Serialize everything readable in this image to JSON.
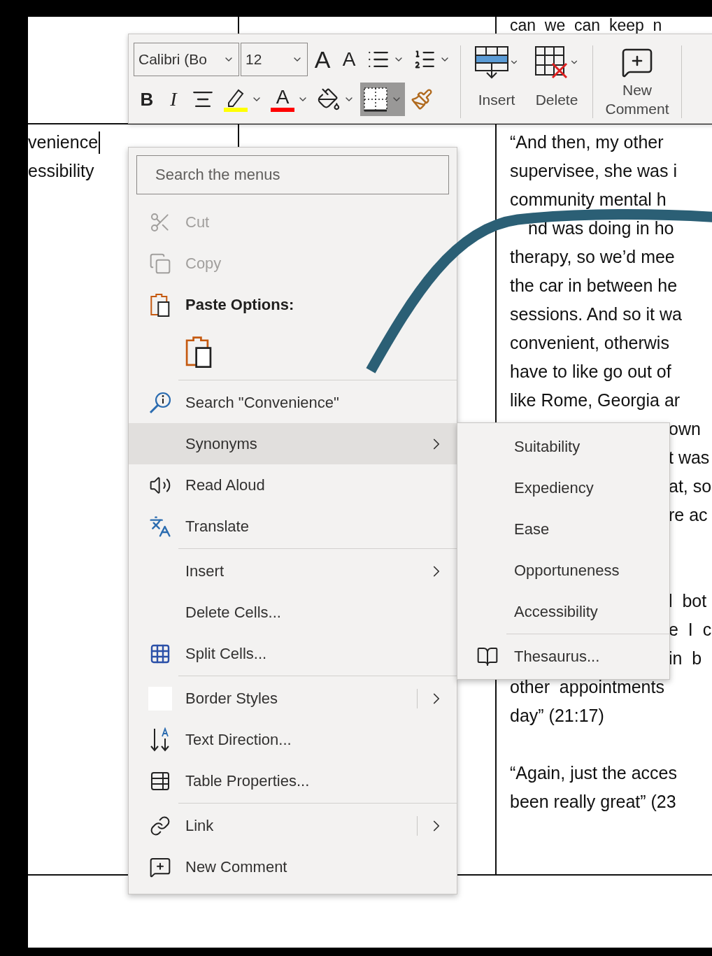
{
  "document": {
    "top_right_cell": "can  we  can  keep  n",
    "left_lines": [
      "venience",
      "essibility"
    ],
    "cursor": true,
    "right_lines": [
      {
        "kind": "line",
        "text": "“And then, my other"
      },
      {
        "kind": "line",
        "text": "supervisee, she was i"
      },
      {
        "kind": "line",
        "text": "community mental h"
      },
      {
        "kind": "after-arc",
        "text": "nd was doing in ho"
      },
      {
        "kind": "line",
        "text": "therapy, so we’d mee"
      },
      {
        "kind": "line",
        "text": "the car in between he"
      },
      {
        "kind": "line",
        "text": "sessions. And so it wa"
      },
      {
        "kind": "line",
        "text": "convenient, otherwis"
      },
      {
        "kind": "line",
        "text": "have to like go out of"
      },
      {
        "kind": "line",
        "text": "like Rome, Georgia ar"
      },
      {
        "kind": "covered",
        "text": "own"
      },
      {
        "kind": "covered",
        "text": "t was"
      },
      {
        "kind": "covered",
        "text": "at, so"
      },
      {
        "kind": "covered",
        "text": "re ac"
      },
      {
        "kind": "gap"
      },
      {
        "kind": "gap"
      },
      {
        "kind": "covered",
        "text": "l  bot"
      },
      {
        "kind": "covered",
        "text": "e  I  c"
      },
      {
        "kind": "covered",
        "text": "in  b"
      },
      {
        "kind": "line",
        "text": "other  appointments"
      },
      {
        "kind": "line",
        "text": "day” (21:17)"
      },
      {
        "kind": "gap"
      },
      {
        "kind": "line",
        "text": "“Again, just the acces"
      },
      {
        "kind": "line",
        "text": "been really great” (23"
      }
    ]
  },
  "mini_toolbar": {
    "font": "Calibri (Bo",
    "size": "12",
    "row1": [
      {
        "kind": "grow",
        "glyph": "A",
        "dropdown": false
      },
      {
        "kind": "shrink",
        "glyph": "A",
        "dropdown": false
      },
      {
        "kind": "bullets",
        "dropdown": true
      },
      {
        "kind": "numbering",
        "dropdown": true
      }
    ],
    "row2": [
      {
        "kind": "bold",
        "glyph": "B",
        "dropdown": false,
        "selected": false
      },
      {
        "kind": "italic",
        "glyph": "I",
        "dropdown": false,
        "selected": false
      },
      {
        "kind": "align",
        "dropdown": false,
        "selected": false
      },
      {
        "kind": "highlight",
        "color": "#ffff00",
        "dropdown": true,
        "selected": false
      },
      {
        "kind": "font-color",
        "glyph": "A",
        "color": "#ff0000",
        "dropdown": true,
        "selected": false
      },
      {
        "kind": "shading",
        "dropdown": true,
        "selected": false
      },
      {
        "kind": "borders",
        "dropdown": true,
        "selected": true
      },
      {
        "kind": "painter",
        "dropdown": false,
        "selected": false
      }
    ],
    "big_buttons": [
      {
        "kind": "insert",
        "label": "Insert",
        "dropdown": true
      },
      {
        "kind": "delete",
        "label": "Delete",
        "dropdown": true
      },
      {
        "kind": "comment",
        "label": "New Comment",
        "dropdown": false
      }
    ]
  },
  "menu": {
    "search": {
      "placeholder": "Search the menus"
    },
    "items": [
      {
        "kind": "item",
        "label": "Cut",
        "disabled": true,
        "selected": false,
        "submenu": false,
        "split": false
      },
      {
        "kind": "item",
        "label": "Copy",
        "disabled": true,
        "selected": false,
        "submenu": false,
        "split": false
      },
      {
        "kind": "header",
        "label": "Paste Options:"
      },
      {
        "kind": "paste-icons"
      },
      {
        "kind": "separator"
      },
      {
        "kind": "item",
        "label": "Search \"Convenience\"",
        "disabled": false,
        "selected": false,
        "submenu": false,
        "split": false
      },
      {
        "kind": "item",
        "label": "Synonyms",
        "disabled": false,
        "selected": true,
        "submenu": true,
        "split": false
      },
      {
        "kind": "item",
        "label": "Read Aloud",
        "disabled": false,
        "selected": false,
        "submenu": false,
        "split": false
      },
      {
        "kind": "item",
        "label": "Translate",
        "disabled": false,
        "selected": false,
        "submenu": false,
        "split": false
      },
      {
        "kind": "separator"
      },
      {
        "kind": "item",
        "label": "Insert",
        "disabled": false,
        "selected": false,
        "submenu": true,
        "split": false
      },
      {
        "kind": "item",
        "label": "Delete Cells...",
        "disabled": false,
        "selected": false,
        "submenu": false,
        "split": false
      },
      {
        "kind": "item",
        "label": "Split Cells...",
        "disabled": false,
        "selected": false,
        "submenu": false,
        "split": false
      },
      {
        "kind": "separator"
      },
      {
        "kind": "item",
        "label": "Border Styles",
        "disabled": false,
        "selected": false,
        "submenu": true,
        "split": true
      },
      {
        "kind": "item",
        "label": "Text Direction...",
        "disabled": false,
        "selected": false,
        "submenu": false,
        "split": false
      },
      {
        "kind": "item",
        "label": "Table Properties...",
        "disabled": false,
        "selected": false,
        "submenu": false,
        "split": false
      },
      {
        "kind": "separator"
      },
      {
        "kind": "item",
        "label": "Link",
        "disabled": false,
        "selected": false,
        "submenu": true,
        "split": true
      },
      {
        "kind": "item",
        "label": "New Comment",
        "disabled": false,
        "selected": false,
        "submenu": false,
        "split": false
      }
    ]
  },
  "submenu": {
    "items": [
      {
        "kind": "item",
        "label": "Suitability"
      },
      {
        "kind": "item",
        "label": "Expediency"
      },
      {
        "kind": "item",
        "label": "Ease"
      },
      {
        "kind": "item",
        "label": "Opportuneness"
      },
      {
        "kind": "item",
        "label": "Accessibility"
      },
      {
        "kind": "separator"
      },
      {
        "kind": "thesaurus",
        "label": "Thesaurus..."
      }
    ]
  }
}
